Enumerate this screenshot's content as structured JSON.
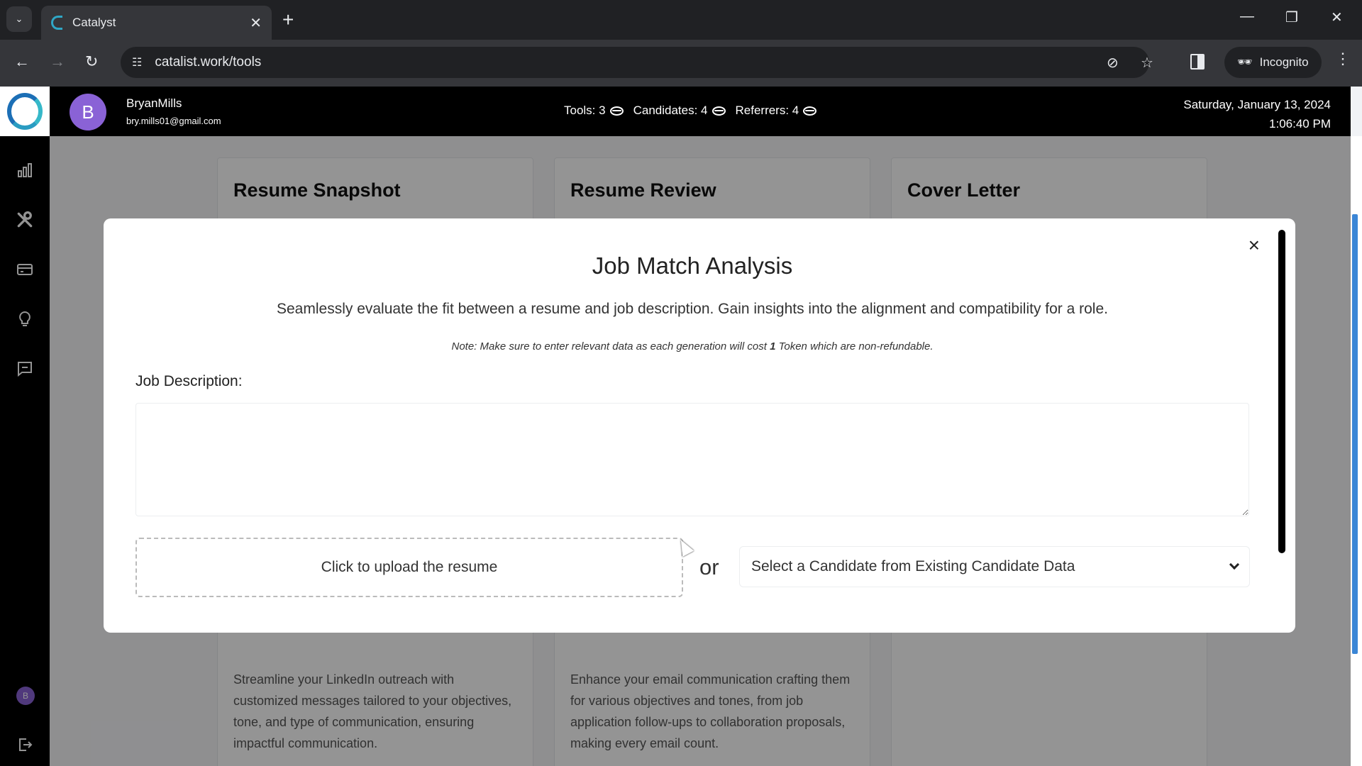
{
  "browser": {
    "tab_title": "Catalyst",
    "url": "catalist.work/tools",
    "incognito_label": "Incognito",
    "icons": [
      "tab-search-icon",
      "close-icon",
      "new-tab-icon",
      "minimize-icon",
      "restore-icon",
      "window-close-icon",
      "back-icon",
      "forward-icon",
      "reload-icon",
      "site-info-icon",
      "eye-off-icon",
      "star-icon",
      "side-panel-icon",
      "incognito-icon",
      "more-menu-icon"
    ]
  },
  "header": {
    "avatar_letter": "B",
    "user_name": "BryanMills",
    "user_email": "bry.mills01@gmail.com",
    "stats": [
      {
        "label": "Tools: 3"
      },
      {
        "label": "Candidates: 4"
      },
      {
        "label": "Referrers: 4"
      }
    ],
    "date": "Saturday, January 13, 2024",
    "time": "1:06:40 PM"
  },
  "sidebar": {
    "items": [
      {
        "name": "analytics",
        "icon": "bar-chart-icon"
      },
      {
        "name": "tools",
        "icon": "tools-icon"
      },
      {
        "name": "billing",
        "icon": "credit-card-icon"
      },
      {
        "name": "ideas",
        "icon": "lightbulb-icon"
      },
      {
        "name": "messages",
        "icon": "message-icon"
      }
    ],
    "avatar_letter": "B",
    "logout_icon": "logout-icon"
  },
  "cards": [
    {
      "title": "Resume Snapshot",
      "description": "Streamline your LinkedIn outreach with customized messages tailored to your objectives, tone, and type of communication, ensuring impactful communication."
    },
    {
      "title": "Resume Review",
      "description": "Enhance your email communication crafting them for various objectives and tones, from job application follow-ups to collaboration proposals, making every email count."
    },
    {
      "title": "Cover Letter",
      "description": ""
    }
  ],
  "modal": {
    "title": "Job Match Analysis",
    "subtitle": "Seamlessly evaluate the fit between a resume and job description. Gain insights into the alignment and compatibility for a role.",
    "note_prefix": "Note: Make sure to enter relevant data as each generation will cost ",
    "note_cost": "1",
    "note_suffix": " Token which are non-refundable.",
    "job_description_label": "Job Description:",
    "job_description_value": "",
    "upload_label": "Click to upload the resume",
    "or_label": "or",
    "candidate_select": "Select a Candidate from Existing Candidate Data",
    "close_label": "×"
  }
}
